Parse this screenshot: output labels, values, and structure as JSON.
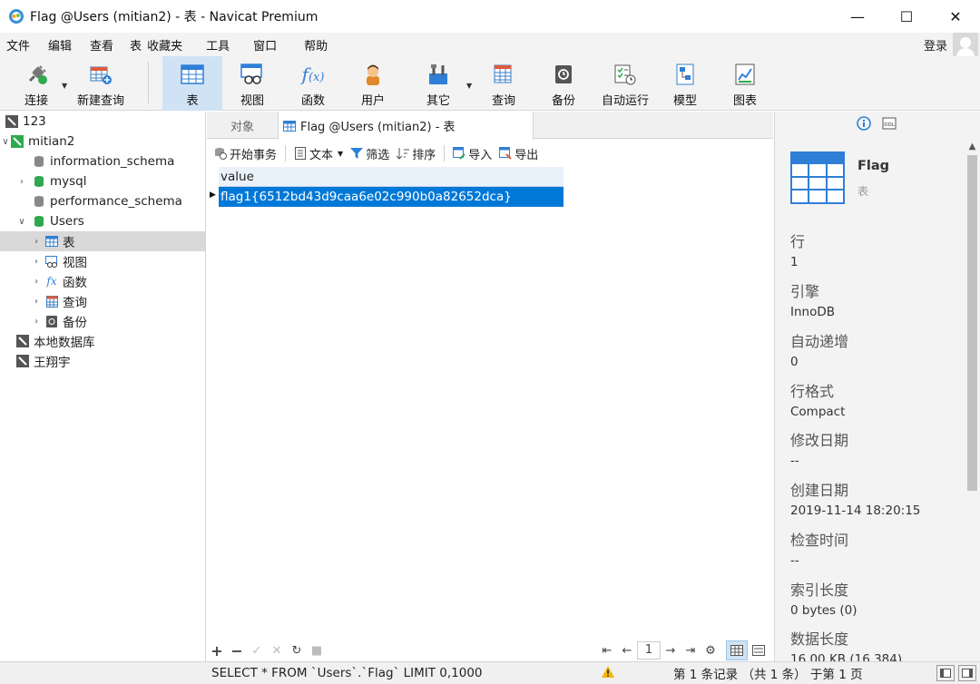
{
  "window": {
    "title": "Flag @Users (mitian2) - 表 - Navicat Premium",
    "minimize": "—",
    "maximize": "☐",
    "close": "✕"
  },
  "menu": {
    "items": [
      "文件",
      "编辑",
      "查看",
      "表",
      "收藏夹",
      "工具",
      "窗口",
      "帮助"
    ],
    "login": "登录"
  },
  "toolbar": {
    "connect": "连接",
    "new_query": "新建查询",
    "table": "表",
    "view": "视图",
    "function": "函数",
    "user": "用户",
    "other": "其它",
    "query": "查询",
    "backup": "备份",
    "automation": "自动运行",
    "model": "模型",
    "chart": "图表"
  },
  "sidebar": {
    "items": [
      {
        "label": "123"
      },
      {
        "label": "mitian2"
      },
      {
        "label": "information_schema"
      },
      {
        "label": "mysql"
      },
      {
        "label": "performance_schema"
      },
      {
        "label": "Users"
      },
      {
        "label": "表"
      },
      {
        "label": "视图"
      },
      {
        "label": "函数"
      },
      {
        "label": "查询"
      },
      {
        "label": "备份"
      },
      {
        "label": "本地数据库"
      },
      {
        "label": "王翔宇"
      }
    ]
  },
  "tabs": {
    "objects": "对象",
    "active": "Flag @Users (mitian2) - 表"
  },
  "subtoolbar": {
    "begin_transaction": "开始事务",
    "text": "文本",
    "filter": "筛选",
    "sort": "排序",
    "import": "导入",
    "export": "导出"
  },
  "grid": {
    "column": "value",
    "rows": [
      "flag1{6512bd43d9caa6e02c990b0a82652dca}"
    ]
  },
  "gridbar": {
    "page": "1"
  },
  "info": {
    "name": "Flag",
    "type": "表",
    "props": [
      {
        "k": "行",
        "v": "1"
      },
      {
        "k": "引擎",
        "v": "InnoDB"
      },
      {
        "k": "自动递增",
        "v": "0"
      },
      {
        "k": "行格式",
        "v": "Compact"
      },
      {
        "k": "修改日期",
        "v": "--"
      },
      {
        "k": "创建日期",
        "v": "2019-11-14 18:20:15"
      },
      {
        "k": "检查时间",
        "v": "--"
      },
      {
        "k": "索引长度",
        "v": "0 bytes (0)"
      },
      {
        "k": "数据长度",
        "v": "16.00 KB (16,384)"
      }
    ]
  },
  "status": {
    "sql": "SELECT * FROM `Users`.`Flag` LIMIT 0,1000",
    "records": "第 1 条记录 （共 1 条） 于第 1 页"
  },
  "colors": {
    "accent": "#0078d7",
    "selected_toolbar": "#cfe3f5",
    "green_db": "#2fa84f"
  }
}
